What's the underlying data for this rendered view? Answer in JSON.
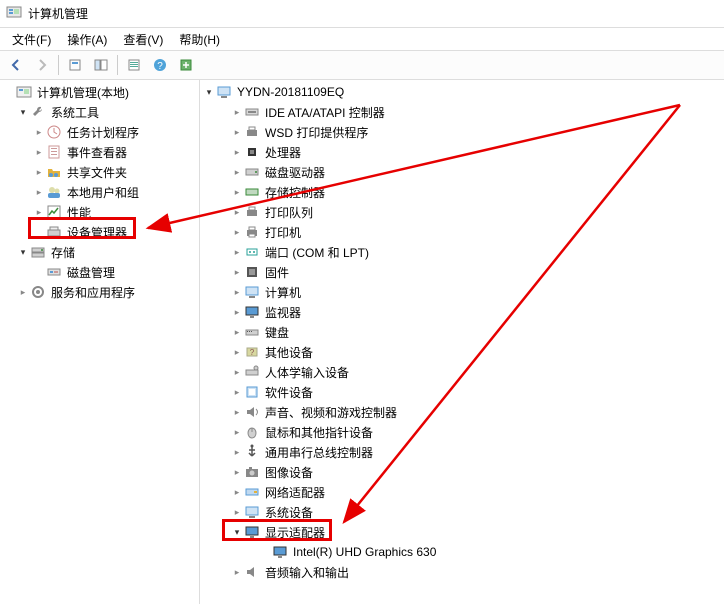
{
  "title": "计算机管理",
  "menus": {
    "file": "文件(F)",
    "action": "操作(A)",
    "view": "查看(V)",
    "help": "帮助(H)"
  },
  "leftTree": {
    "root": "计算机管理(本地)",
    "systemTools": "系统工具",
    "taskScheduler": "任务计划程序",
    "eventViewer": "事件查看器",
    "sharedFolders": "共享文件夹",
    "localUsersGroups": "本地用户和组",
    "performance": "性能",
    "deviceManager": "设备管理器",
    "storage": "存储",
    "diskManagement": "磁盘管理",
    "servicesApps": "服务和应用程序"
  },
  "rightTree": {
    "computerName": "YYDN-20181109EQ",
    "ideAta": "IDE ATA/ATAPI 控制器",
    "wsd": "WSD 打印提供程序",
    "processors": "处理器",
    "diskDrives": "磁盘驱动器",
    "storageControllers": "存储控制器",
    "printQueues": "打印队列",
    "printers": "打印机",
    "ports": "端口 (COM 和 LPT)",
    "firmware": "固件",
    "computers": "计算机",
    "monitors": "监视器",
    "keyboards": "键盘",
    "otherDevices": "其他设备",
    "hid": "人体学输入设备",
    "softwareDevices": "软件设备",
    "soundVideoGame": "声音、视频和游戏控制器",
    "mice": "鼠标和其他指针设备",
    "usb": "通用串行总线控制器",
    "imaging": "图像设备",
    "networkAdapters": "网络适配器",
    "systemDevices": "系统设备",
    "displayAdapters": "显示适配器",
    "displayChild": "Intel(R) UHD Graphics 630",
    "audioIO": "音频输入和输出"
  }
}
